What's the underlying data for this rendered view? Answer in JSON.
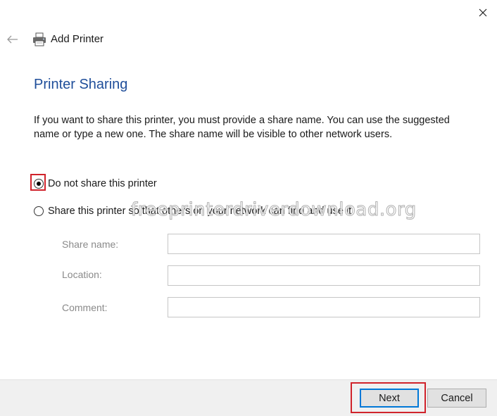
{
  "window": {
    "title": "Add Printer",
    "close_icon": "close-icon",
    "back_icon": "back-arrow-icon",
    "printer_icon": "printer-icon"
  },
  "page": {
    "heading": "Printer Sharing",
    "description": "If you want to share this printer, you must provide a share name. You can use the suggested name or type a new one. The share name will be visible to other network users."
  },
  "options": {
    "no_share_label": "Do not share this printer",
    "share_label": "Share this printer so that others on your network can find and use it",
    "selected": "no_share"
  },
  "fields": {
    "share_name_label": "Share name:",
    "share_name_value": "",
    "location_label": "Location:",
    "location_value": "",
    "comment_label": "Comment:",
    "comment_value": ""
  },
  "watermark": "freeprinterdriverdownload.org",
  "footer": {
    "next_label": "Next",
    "cancel_label": "Cancel"
  },
  "colors": {
    "heading": "#1f4e9a",
    "highlight": "#d0232b",
    "default_button_border": "#0078d7"
  }
}
